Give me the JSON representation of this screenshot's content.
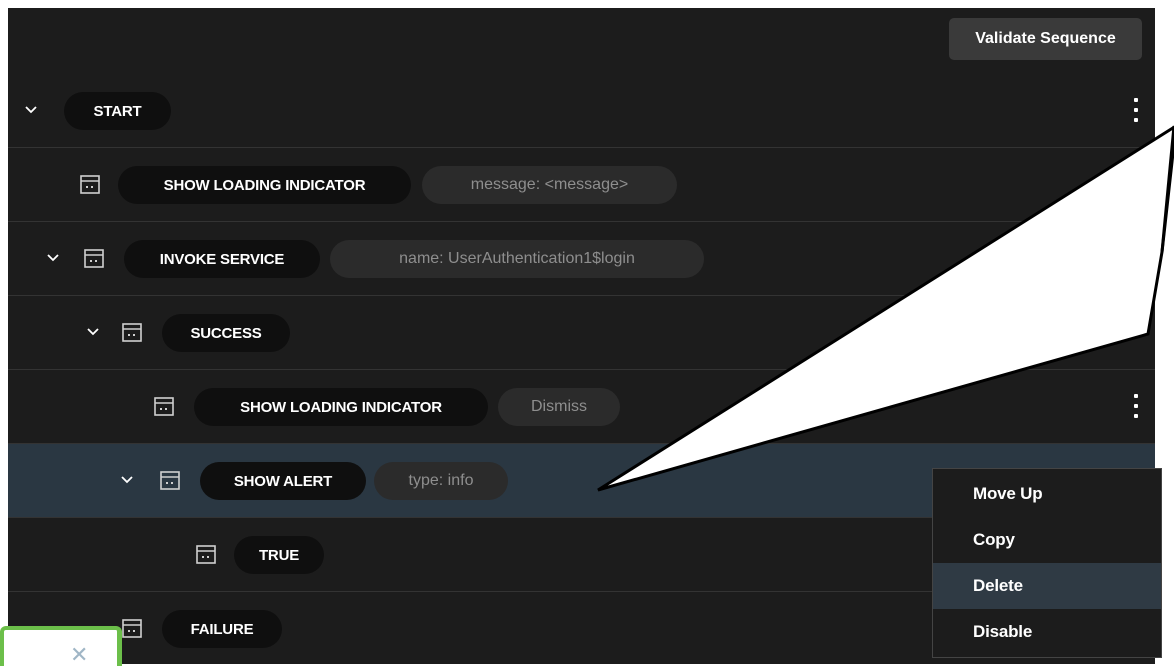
{
  "toolbar": {
    "validate_label": "Validate Sequence"
  },
  "rows": [
    {
      "label": "START",
      "param": ""
    },
    {
      "label": "SHOW LOADING INDICATOR",
      "param": "message: <message>"
    },
    {
      "label": "INVOKE SERVICE",
      "param": "name: UserAuthentication1$login"
    },
    {
      "label": "SUCCESS",
      "param": ""
    },
    {
      "label": "SHOW LOADING INDICATOR",
      "param": "Dismiss"
    },
    {
      "label": "SHOW ALERT",
      "param": "type: info"
    },
    {
      "label": "TRUE",
      "param": ""
    },
    {
      "label": "FAILURE",
      "param": ""
    }
  ],
  "context_menu": {
    "items": [
      "Move Up",
      "Copy",
      "Delete",
      "Disable"
    ],
    "highlighted": "Delete"
  },
  "colors": {
    "panel_bg": "#1c1c1c",
    "selected_row": "#2a3742",
    "menu_highlight": "#2f3a44",
    "pill_bg": "#0f0f0f",
    "param_bg": "#2b2b2b",
    "mini_window_border": "#6cbf4a"
  },
  "icons": [
    "chevron-down-icon",
    "step-icon",
    "kebab-menu-icon",
    "close-icon"
  ]
}
